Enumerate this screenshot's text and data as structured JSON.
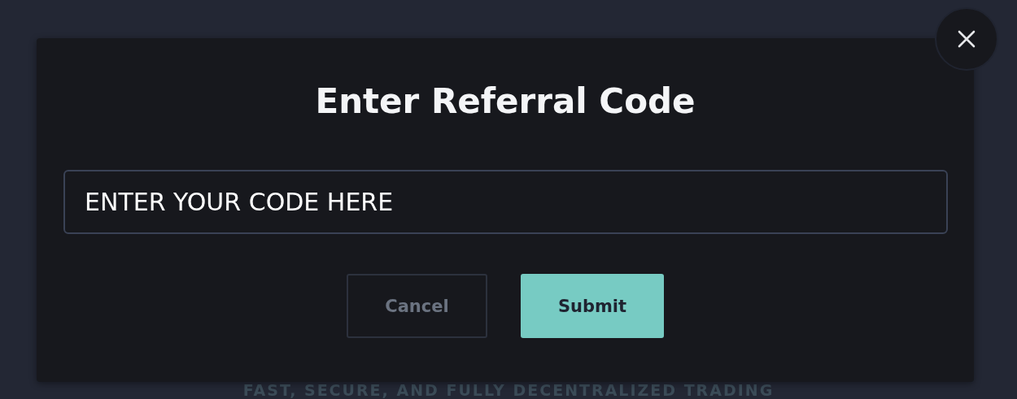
{
  "dialog": {
    "title": "Enter Referral Code",
    "field": {
      "value": "ENTER YOUR CODE HERE"
    },
    "buttons": [
      {
        "label": "Cancel",
        "kind": "secondary"
      },
      {
        "label": "Submit",
        "kind": "primary"
      }
    ]
  },
  "background": {
    "tagline": "FAST, SECURE, AND FULLY DECENTRALIZED TRADING"
  }
}
